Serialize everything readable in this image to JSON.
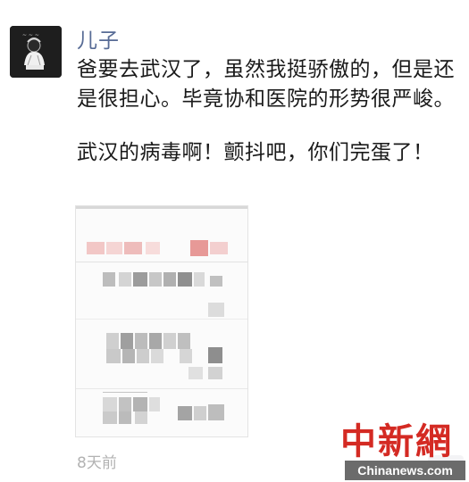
{
  "post": {
    "author": "儿子",
    "paragraph1": "爸要去武汉了，虽然我挺骄傲的，但是还是很担心。毕竟协和医院的形势很严峻。",
    "paragraph2": "武汉的病毒啊！颤抖吧，你们完蛋了！",
    "time": "8天前",
    "more_icon": "ellipsis-icon"
  },
  "watermark": {
    "logo": "中新網",
    "url": "Chinanews.com"
  },
  "colors": {
    "name_link": "#576b95",
    "time_gray": "#b2b2b2",
    "watermark_red": "#d42a23"
  }
}
